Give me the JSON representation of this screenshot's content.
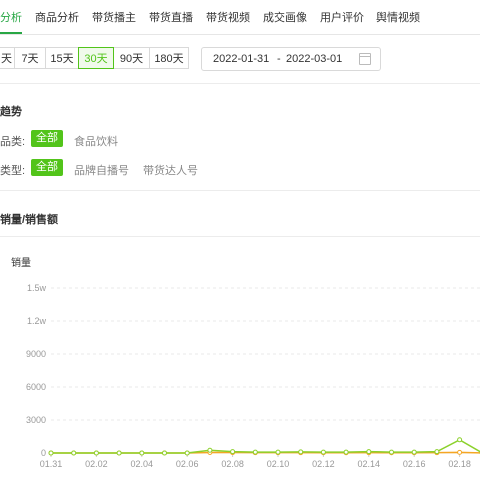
{
  "tabs": [
    "分析",
    "商品分析",
    "带货播主",
    "带货直播",
    "带货视频",
    "成交画像",
    "用户评价",
    "舆情视频"
  ],
  "range": {
    "buttons": [
      "天",
      "7天",
      "15天",
      "30天",
      "90天",
      "180天"
    ],
    "active": "30天",
    "start_date": "2022-01-31",
    "separator": "-",
    "end_date": "2022-03-01"
  },
  "trend": {
    "title": "趋势",
    "category_label": "品类:",
    "category_options": [
      "全部",
      "食品饮料"
    ],
    "type_label": "类型:",
    "type_options": [
      "全部",
      "品牌自播号",
      "带货达人号"
    ]
  },
  "sales": {
    "title": "销量/销售额",
    "y_title": "销量"
  },
  "colors": {
    "accent": "#52c41a",
    "series_green": "#8bd12b",
    "series_orange": "#f5a623"
  },
  "chart_data": {
    "type": "line",
    "y_axis_title": "销量",
    "y_ticks": [
      "0",
      "3000",
      "6000",
      "9000",
      "1.2w",
      "1.5w"
    ],
    "ylim": [
      0,
      15000
    ],
    "x_tick_labels": [
      "01.31",
      "02.02",
      "02.04",
      "02.06",
      "02.08",
      "02.10",
      "02.12",
      "02.14",
      "02.16",
      "02.18"
    ],
    "x": [
      "01.31",
      "02.01",
      "02.02",
      "02.03",
      "02.04",
      "02.05",
      "02.06",
      "02.07",
      "02.08",
      "02.09",
      "02.10",
      "02.11",
      "02.12",
      "02.13",
      "02.14",
      "02.15",
      "02.16",
      "02.17",
      "02.18",
      "02.19"
    ],
    "grid": true,
    "series": [
      {
        "color": "#8bd12b",
        "values": [
          0,
          0,
          0,
          0,
          0,
          0,
          0,
          250,
          120,
          80,
          80,
          100,
          80,
          80,
          120,
          80,
          80,
          120,
          1200,
          0
        ]
      },
      {
        "color": "#f5a623",
        "values": [
          0,
          0,
          0,
          0,
          0,
          0,
          0,
          50,
          40,
          30,
          30,
          30,
          20,
          20,
          30,
          20,
          20,
          30,
          60,
          0
        ]
      }
    ]
  }
}
